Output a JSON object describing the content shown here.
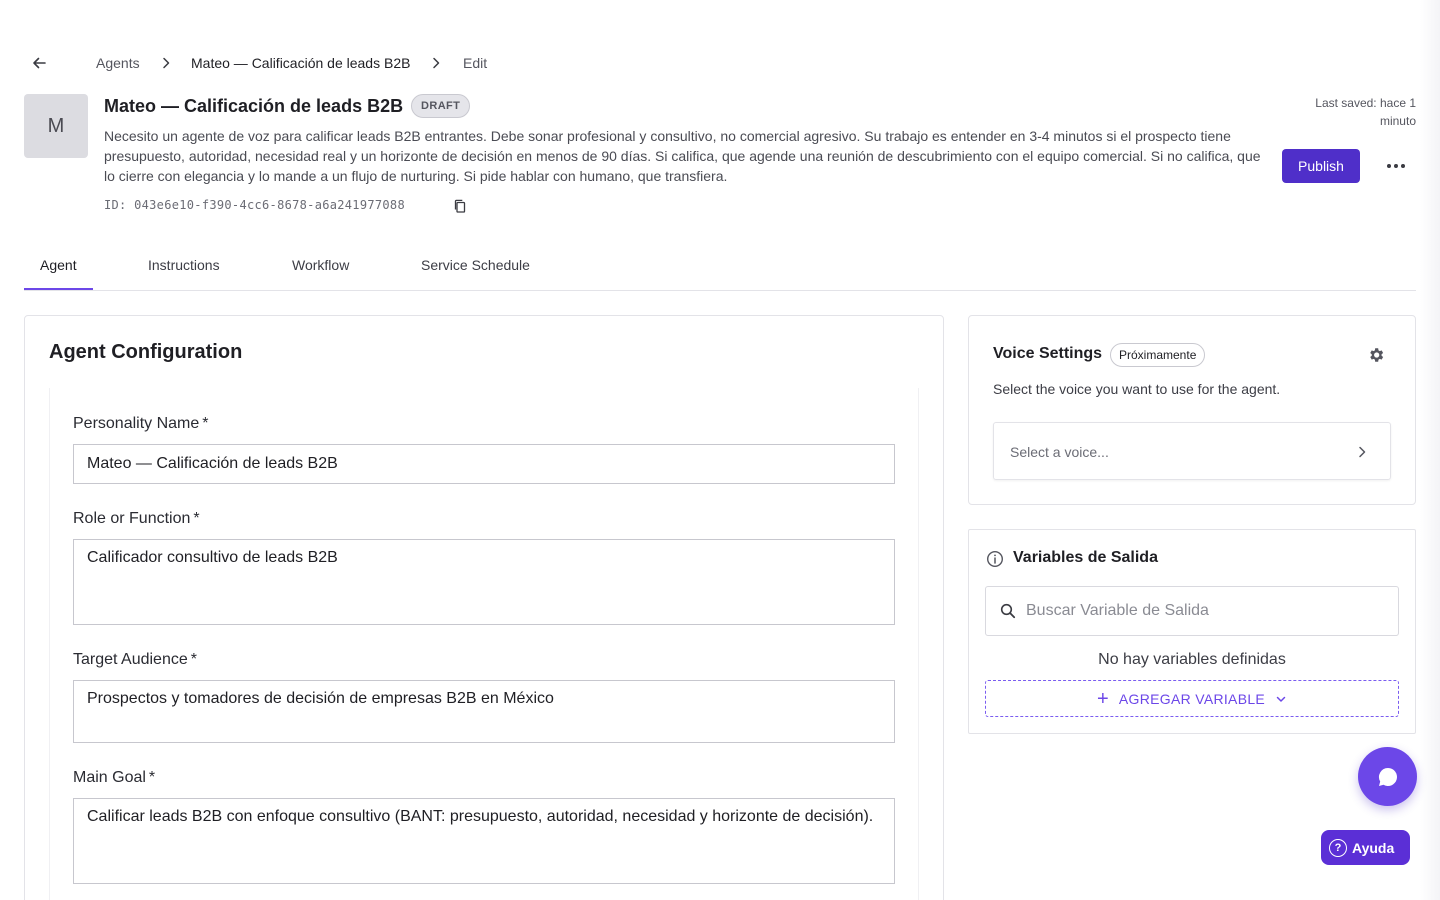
{
  "breadcrumb": {
    "items": [
      "Agents",
      "Mateo — Calificación de leads B2B",
      "Edit"
    ]
  },
  "header": {
    "avatar_letter": "M",
    "title": "Mateo — Calificación de leads B2B",
    "status_badge": "DRAFT",
    "description": "Necesito un agente de voz para calificar leads B2B entrantes. Debe sonar profesional y consultivo, no comercial agresivo. Su trabajo es entender en 3-4 minutos si el prospecto tiene presupuesto, autoridad, necesidad real y un horizonte de decisión en menos de 90 días. Si califica, que agende una reunión de descubrimiento con el equipo comercial. Si no califica, que lo cierre con elegancia y lo mande a un flujo de nurturing. Si pide hablar con humano, que transfiera.",
    "id_text": "ID: 043e6e10-f390-4cc6-8678-a6a241977088",
    "last_saved": "Last saved: hace 1 minuto",
    "publish_label": "Publish"
  },
  "tabs": [
    {
      "label": "Agent",
      "active": true
    },
    {
      "label": "Instructions",
      "active": false
    },
    {
      "label": "Workflow",
      "active": false
    },
    {
      "label": "Service Schedule",
      "active": false
    }
  ],
  "agent_config": {
    "title": "Agent Configuration",
    "fields": [
      {
        "label": "Personality Name",
        "required_mark": "*",
        "value": "Mateo — Calificación de leads B2B"
      },
      {
        "label": "Role or Function",
        "required_mark": "*",
        "value": "Calificador consultivo de leads B2B"
      },
      {
        "label": "Target Audience",
        "required_mark": "*",
        "value": "Prospectos y tomadores de decisión de empresas B2B en México"
      },
      {
        "label": "Main Goal",
        "required_mark": "*",
        "value": "Calificar leads B2B con enfoque consultivo (BANT: presupuesto, autoridad, necesidad y horizonte de decisión)."
      }
    ]
  },
  "voice_settings": {
    "title": "Voice Settings",
    "badge": "Próximamente",
    "subtitle": "Select the voice you want to use for the agent.",
    "select_placeholder": "Select a voice..."
  },
  "output_variables": {
    "title": "Variables de Salida",
    "search_placeholder": "Buscar Variable de Salida",
    "empty_text": "No hay variables definidas",
    "add_label": "AGREGAR VARIABLE"
  },
  "help": {
    "label": "Ayuda"
  },
  "colors": {
    "accent": "#6c47e8",
    "publish": "#4f2fc9"
  }
}
